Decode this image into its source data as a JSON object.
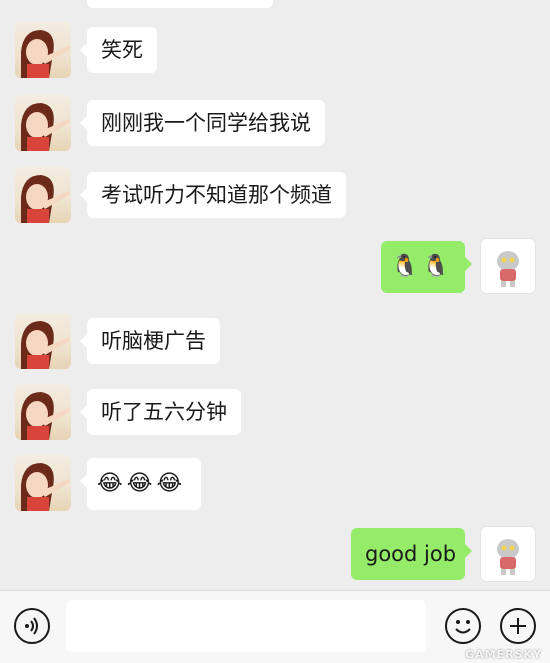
{
  "messages": [
    {
      "side": "in",
      "text": "笑死"
    },
    {
      "side": "in",
      "text": "刚刚我一个同学给我说"
    },
    {
      "side": "in",
      "text": "考试听力不知道那个频道"
    },
    {
      "side": "out",
      "emojis": [
        "penguin-emoji",
        "penguin-emoji"
      ]
    },
    {
      "side": "in",
      "text": "听脑梗广告"
    },
    {
      "side": "in",
      "text": "听了五六分钟"
    },
    {
      "side": "in",
      "emojis": [
        "laugh-cry-emoji",
        "laugh-cry-emoji",
        "laugh-cry-emoji"
      ]
    },
    {
      "side": "out",
      "text": "good job"
    }
  ],
  "emoji_glyphs": {
    "laugh-cry-emoji": "😂",
    "penguin-emoji": "🐧"
  },
  "input": {
    "value": ""
  },
  "watermark": "GAMERSKY",
  "colors": {
    "chat_bg": "#ededed",
    "out_bubble": "#95ec69",
    "in_bubble": "#ffffff"
  }
}
